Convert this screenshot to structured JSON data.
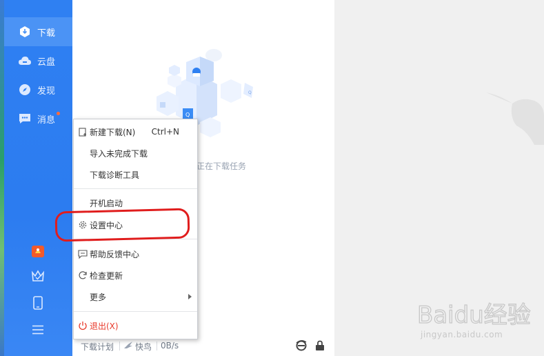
{
  "sidebar": {
    "items": [
      {
        "label": "下载",
        "icon": "download-icon",
        "active": true
      },
      {
        "label": "云盘",
        "icon": "cloud-icon"
      },
      {
        "label": "发现",
        "icon": "compass-icon"
      },
      {
        "label": "消息",
        "icon": "message-icon",
        "badge": true
      }
    ],
    "bottom_icons": [
      "game-icon",
      "crown-icon",
      "phone-icon",
      "menu-icon"
    ]
  },
  "main": {
    "empty_text": "正在下载任务"
  },
  "statusbar": {
    "plan": "下载计划",
    "bird": "快鸟",
    "speed": "0B/s",
    "icons": [
      "ie-icon",
      "lock-icon"
    ]
  },
  "menu": {
    "items": [
      {
        "label": "新建下载(N)",
        "shortcut": "Ctrl+N",
        "icon": "new-download-icon"
      },
      {
        "label": "导入未完成下载"
      },
      {
        "label": "下载诊断工具"
      },
      {
        "label": "开机启动"
      },
      {
        "label": "设置中心",
        "icon": "gear-icon"
      },
      {
        "label": "帮助反馈中心",
        "icon": "help-chat-icon"
      },
      {
        "label": "检查更新",
        "icon": "refresh-icon"
      },
      {
        "label": "更多",
        "submenu": true
      },
      {
        "label": "退出(X)",
        "icon": "power-icon",
        "color": "#e8392a"
      }
    ]
  },
  "watermark": {
    "logo": "Baidu经验",
    "url": "jingyan.baidu.com"
  },
  "colors": {
    "sidebar": "#2f80f2",
    "accent_highlight": "#e01d1d",
    "exit": "#e8392a"
  }
}
